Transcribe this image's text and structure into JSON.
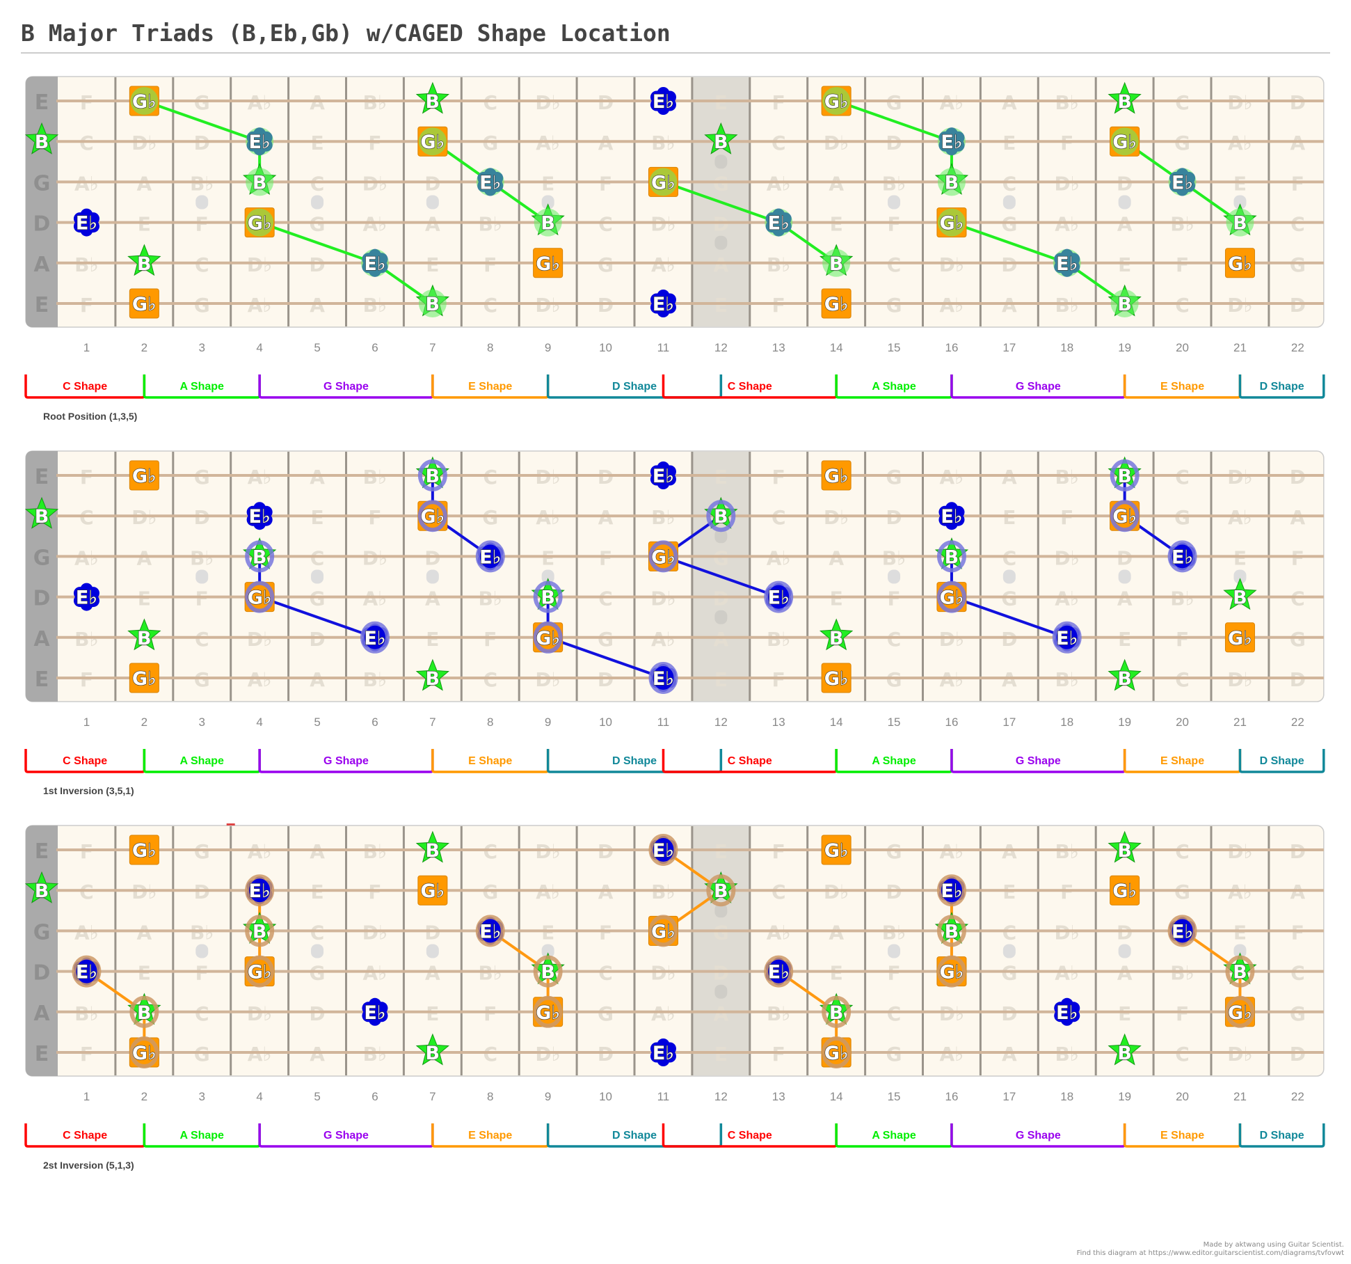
{
  "title": "B Major Triads (B,Eb,Gb) w/CAGED Shape Location",
  "strings": [
    "E",
    "B",
    "G",
    "D",
    "A",
    "E"
  ],
  "fret_count": 22,
  "fret_numbers": [
    "1",
    "2",
    "3",
    "4",
    "5",
    "6",
    "7",
    "8",
    "9",
    "10",
    "11",
    "12",
    "13",
    "14",
    "15",
    "16",
    "17",
    "18",
    "19",
    "20",
    "21",
    "22"
  ],
  "inlay_frets": [
    3,
    5,
    7,
    9,
    15,
    17,
    19,
    21
  ],
  "double_inlay_frets": [
    12
  ],
  "highlight_frets": [
    12
  ],
  "background_notes": [
    [
      "E",
      "F",
      "Gb",
      "G",
      "Ab",
      "A",
      "Bb",
      "B",
      "C",
      "Db",
      "D",
      "Eb",
      "E",
      "F",
      "Gb",
      "G",
      "Ab",
      "A",
      "Bb",
      "B",
      "C",
      "Db",
      "D"
    ],
    [
      "B",
      "C",
      "Db",
      "D",
      "Eb",
      "E",
      "F",
      "Gb",
      "G",
      "Ab",
      "A",
      "Bb",
      "B",
      "C",
      "Db",
      "D",
      "Eb",
      "E",
      "F",
      "Gb",
      "G",
      "Ab",
      "A"
    ],
    [
      "G",
      "Ab",
      "A",
      "Bb",
      "B",
      "C",
      "Db",
      "D",
      "Eb",
      "E",
      "F",
      "Gb",
      "G",
      "Ab",
      "A",
      "Bb",
      "B",
      "C",
      "Db",
      "D",
      "Eb",
      "E",
      "F"
    ],
    [
      "D",
      "Eb",
      "E",
      "F",
      "Gb",
      "G",
      "Ab",
      "A",
      "Bb",
      "B",
      "C",
      "Db",
      "D",
      "Eb",
      "E",
      "F",
      "Gb",
      "G",
      "Ab",
      "A",
      "Bb",
      "B",
      "C"
    ],
    [
      "A",
      "Bb",
      "B",
      "C",
      "Db",
      "D",
      "Eb",
      "E",
      "F",
      "Gb",
      "G",
      "Ab",
      "A",
      "Bb",
      "B",
      "C",
      "Db",
      "D",
      "Eb",
      "E",
      "F",
      "Gb",
      "G"
    ],
    [
      "E",
      "F",
      "Gb",
      "G",
      "Ab",
      "A",
      "Bb",
      "B",
      "C",
      "Db",
      "D",
      "Eb",
      "E",
      "F",
      "Gb",
      "G",
      "Ab",
      "A",
      "Bb",
      "B",
      "C",
      "Db",
      "D"
    ]
  ],
  "note_styles": {
    "B": {
      "label": "B",
      "shape": "star",
      "color": "#22ee22",
      "role": "root"
    },
    "Eb": {
      "label": "Eb",
      "shape": "flower",
      "color": "#0000dd",
      "role": "third"
    },
    "Gb": {
      "label": "Gb",
      "shape": "square",
      "color": "#ff9900",
      "role": "fifth"
    }
  },
  "chord_tones": [
    {
      "note": "B",
      "string": 0,
      "fret": 7
    },
    {
      "note": "B",
      "string": 0,
      "fret": 19
    },
    {
      "note": "B",
      "string": 1,
      "fret": 0
    },
    {
      "note": "B",
      "string": 1,
      "fret": 12
    },
    {
      "note": "B",
      "string": 2,
      "fret": 4
    },
    {
      "note": "B",
      "string": 2,
      "fret": 16
    },
    {
      "note": "B",
      "string": 3,
      "fret": 9
    },
    {
      "note": "B",
      "string": 3,
      "fret": 21
    },
    {
      "note": "B",
      "string": 4,
      "fret": 2
    },
    {
      "note": "B",
      "string": 4,
      "fret": 14
    },
    {
      "note": "B",
      "string": 5,
      "fret": 7
    },
    {
      "note": "B",
      "string": 5,
      "fret": 19
    },
    {
      "note": "Eb",
      "string": 0,
      "fret": 11
    },
    {
      "note": "Eb",
      "string": 1,
      "fret": 4
    },
    {
      "note": "Eb",
      "string": 1,
      "fret": 16
    },
    {
      "note": "Eb",
      "string": 2,
      "fret": 8
    },
    {
      "note": "Eb",
      "string": 2,
      "fret": 20
    },
    {
      "note": "Eb",
      "string": 3,
      "fret": 1
    },
    {
      "note": "Eb",
      "string": 3,
      "fret": 13
    },
    {
      "note": "Eb",
      "string": 4,
      "fret": 6
    },
    {
      "note": "Eb",
      "string": 4,
      "fret": 18
    },
    {
      "note": "Eb",
      "string": 5,
      "fret": 11
    },
    {
      "note": "Gb",
      "string": 0,
      "fret": 2
    },
    {
      "note": "Gb",
      "string": 0,
      "fret": 14
    },
    {
      "note": "Gb",
      "string": 1,
      "fret": 7
    },
    {
      "note": "Gb",
      "string": 1,
      "fret": 19
    },
    {
      "note": "Gb",
      "string": 2,
      "fret": 11
    },
    {
      "note": "Gb",
      "string": 3,
      "fret": 4
    },
    {
      "note": "Gb",
      "string": 3,
      "fret": 16
    },
    {
      "note": "Gb",
      "string": 4,
      "fret": 9
    },
    {
      "note": "Gb",
      "string": 4,
      "fret": 21
    },
    {
      "note": "Gb",
      "string": 5,
      "fret": 2
    },
    {
      "note": "Gb",
      "string": 5,
      "fret": 14
    }
  ],
  "caged_shapes": [
    {
      "label": "C Shape",
      "color": "#ff0000",
      "from": 0,
      "to": 2
    },
    {
      "label": "A Shape",
      "color": "#00ee00",
      "from": 2,
      "to": 4
    },
    {
      "label": "G Shape",
      "color": "#9900ee",
      "from": 4,
      "to": 7
    },
    {
      "label": "E Shape",
      "color": "#ff9900",
      "from": 7,
      "to": 9
    },
    {
      "label": "D Shape",
      "color": "#118899",
      "from": 9,
      "to": 12
    },
    {
      "label": "C Shape",
      "color": "#ff0000",
      "from": 11,
      "to": 14
    },
    {
      "label": "A Shape",
      "color": "#00ee00",
      "from": 14,
      "to": 16
    },
    {
      "label": "G Shape",
      "color": "#9900ee",
      "from": 16,
      "to": 19
    },
    {
      "label": "E Shape",
      "color": "#ff9900",
      "from": 19,
      "to": 21
    },
    {
      "label": "D Shape",
      "color": "#118899",
      "from": 21,
      "to": 23
    }
  ],
  "boards": [
    {
      "caption": "Root Position (1,3,5)",
      "line_color": "#22ee22",
      "halo_color": "#66ee66",
      "connections": [
        [
          [
            0,
            2
          ],
          [
            1,
            4
          ]
        ],
        [
          [
            1,
            4
          ],
          [
            2,
            4
          ]
        ],
        [
          [
            3,
            4
          ],
          [
            4,
            6
          ]
        ],
        [
          [
            4,
            6
          ],
          [
            5,
            7
          ]
        ],
        [
          [
            1,
            7
          ],
          [
            2,
            8
          ]
        ],
        [
          [
            2,
            8
          ],
          [
            3,
            9
          ]
        ],
        [
          [
            2,
            11
          ],
          [
            3,
            13
          ]
        ],
        [
          [
            3,
            13
          ],
          [
            4,
            14
          ]
        ],
        [
          [
            0,
            14
          ],
          [
            1,
            16
          ]
        ],
        [
          [
            1,
            16
          ],
          [
            2,
            16
          ]
        ],
        [
          [
            3,
            16
          ],
          [
            4,
            18
          ]
        ],
        [
          [
            4,
            18
          ],
          [
            5,
            19
          ]
        ],
        [
          [
            1,
            19
          ],
          [
            2,
            20
          ]
        ],
        [
          [
            2,
            20
          ],
          [
            3,
            21
          ]
        ]
      ]
    },
    {
      "caption": "1st Inversion (3,5,1)",
      "line_color": "#1111dd",
      "halo_color": "#7777dd",
      "connections": [
        [
          [
            2,
            4
          ],
          [
            3,
            4
          ]
        ],
        [
          [
            3,
            4
          ],
          [
            4,
            6
          ]
        ],
        [
          [
            0,
            7
          ],
          [
            1,
            7
          ]
        ],
        [
          [
            1,
            7
          ],
          [
            2,
            8
          ]
        ],
        [
          [
            3,
            9
          ],
          [
            4,
            9
          ]
        ],
        [
          [
            4,
            9
          ],
          [
            5,
            11
          ]
        ],
        [
          [
            1,
            12
          ],
          [
            2,
            11
          ]
        ],
        [
          [
            2,
            11
          ],
          [
            3,
            13
          ]
        ],
        [
          [
            2,
            16
          ],
          [
            3,
            16
          ]
        ],
        [
          [
            3,
            16
          ],
          [
            4,
            18
          ]
        ],
        [
          [
            0,
            19
          ],
          [
            1,
            19
          ]
        ],
        [
          [
            1,
            19
          ],
          [
            2,
            20
          ]
        ]
      ]
    },
    {
      "caption": "2st Inversion (5,1,3)",
      "line_color": "#ff9911",
      "halo_color": "#cc9966",
      "connections": [
        [
          [
            3,
            1
          ],
          [
            4,
            2
          ]
        ],
        [
          [
            4,
            2
          ],
          [
            5,
            2
          ]
        ],
        [
          [
            1,
            4
          ],
          [
            2,
            4
          ]
        ],
        [
          [
            2,
            4
          ],
          [
            3,
            4
          ]
        ],
        [
          [
            2,
            8
          ],
          [
            3,
            9
          ]
        ],
        [
          [
            3,
            9
          ],
          [
            4,
            9
          ]
        ],
        [
          [
            0,
            11
          ],
          [
            1,
            12
          ]
        ],
        [
          [
            1,
            12
          ],
          [
            2,
            11
          ]
        ],
        [
          [
            3,
            13
          ],
          [
            4,
            14
          ]
        ],
        [
          [
            4,
            14
          ],
          [
            5,
            14
          ]
        ],
        [
          [
            1,
            16
          ],
          [
            2,
            16
          ]
        ],
        [
          [
            2,
            16
          ],
          [
            3,
            16
          ]
        ],
        [
          [
            2,
            20
          ],
          [
            3,
            21
          ]
        ],
        [
          [
            3,
            21
          ],
          [
            4,
            21
          ]
        ]
      ]
    }
  ],
  "credits": {
    "line1": "Made by aktwang using Guitar Scientist.",
    "line2": "Find this diagram at https://www.editor.guitarscientist.com/diagrams/tvfovwt"
  }
}
